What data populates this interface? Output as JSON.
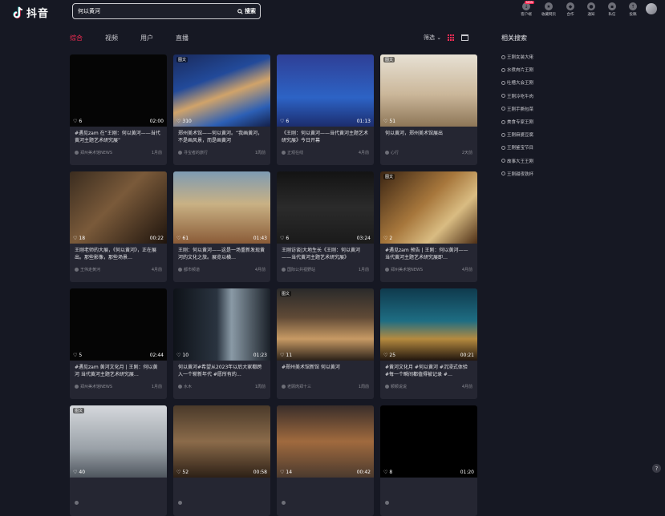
{
  "app": {
    "title": "抖音"
  },
  "search": {
    "value": "何以黄河",
    "button_label": "搜索"
  },
  "top_nav": [
    {
      "label": "客户端",
      "icon": "download-icon",
      "badge": "NEW"
    },
    {
      "label": "收藏网页",
      "icon": "star-icon"
    },
    {
      "label": "合作",
      "icon": "handshake-icon"
    },
    {
      "label": "通知",
      "icon": "bell-icon"
    },
    {
      "label": "私信",
      "icon": "message-icon"
    },
    {
      "label": "投稿",
      "icon": "upload-icon"
    }
  ],
  "filters": {
    "tabs": [
      "综合",
      "视频",
      "用户",
      "直播"
    ],
    "active": "综合",
    "filter_label": "筛选"
  },
  "cards": [
    {
      "thumb": "t-black",
      "likes": "6",
      "duration": "02:00",
      "tag": "",
      "desc": "#遇见zam 在“王刚：何以黄河——当代黄河主题艺术研究展”",
      "author": "郑州美术馆NEWS",
      "time": "1月前"
    },
    {
      "thumb": "t-map",
      "likes": "310",
      "duration": "",
      "tag": "图文",
      "desc": "郑州美术馆——何以黄河。“我画黄河，不是画风景，而是画黄河",
      "author": "寻宝者的旅行",
      "time": "1周前"
    },
    {
      "thumb": "t-poster",
      "likes": "6",
      "duration": "01:13",
      "tag": "",
      "desc": "《王刚：何以黄河——当代黄河主题艺术研究展》今日开幕",
      "author": "正观在线",
      "time": "4月前"
    },
    {
      "thumb": "t-hall",
      "likes": "51",
      "duration": "",
      "tag": "图文",
      "desc": "何以黄河，郑州美术馆展出",
      "author": "心行",
      "time": "2天前"
    },
    {
      "thumb": "t-museum",
      "likes": "18",
      "duration": "00:22",
      "tag": "",
      "desc": "王刚老师的大展，《何以黄河》，正在展出。那些影像，那些场景…",
      "author": "王伟走黄河",
      "time": "4月前"
    },
    {
      "thumb": "t-painting",
      "likes": "61",
      "duration": "01:43",
      "tag": "",
      "desc": "王刚：何以黄河——这是一场重新发现黄河的文化之旅。展览以横…",
      "author": "都市频道",
      "time": "4月前"
    },
    {
      "thumb": "t-news",
      "likes": "6",
      "duration": "03:24",
      "tag": "",
      "desc": "王刚访谈|大地生长《王刚：何以黄河——当代黄河主题艺术研究展》",
      "author": "国际公共视野站",
      "time": "1月前"
    },
    {
      "thumb": "t-gold",
      "likes": "2",
      "duration": "",
      "tag": "图文",
      "desc": "#遇见zam 预告 | 王刚：何以黄河——当代黄河主题艺术研究展即…",
      "author": "郑州美术馆NEWS",
      "time": "4月前"
    },
    {
      "thumb": "t-black",
      "likes": "5",
      "duration": "02:44",
      "tag": "",
      "desc": "#遇见zam 黄河文化月 | 王刚：何以黄河 当代黄河主题艺术研究展…",
      "author": "郑州美术馆NEWS",
      "time": "1月前"
    },
    {
      "thumb": "t-corridor",
      "likes": "10",
      "duration": "01:23",
      "tag": "",
      "desc": "何以黄河#希望从2023年以后大家都跨入一个崭新年代 #愿所有的…",
      "author": "水木",
      "time": "1周前"
    },
    {
      "thumb": "t-gallery",
      "likes": "11",
      "duration": "",
      "tag": "图文",
      "desc": "#郑州美术馆新馆 何以黄河",
      "author": "老顾肉郑十三",
      "time": "1周前"
    },
    {
      "thumb": "t-art",
      "likes": "25",
      "duration": "00:21",
      "tag": "",
      "desc": "#黄河文化月 #何以黄河 #沉浸式体验 #每一个瞬间都值得被记录 #…",
      "author": "颖颖说说",
      "time": "4月前"
    },
    {
      "thumb": "t-building",
      "likes": "40",
      "duration": "",
      "tag": "图文",
      "desc": "",
      "author": "",
      "time": ""
    },
    {
      "thumb": "t-sepia",
      "likes": "52",
      "duration": "00:58",
      "tag": "",
      "desc": "",
      "author": "",
      "time": ""
    },
    {
      "thumb": "t-room",
      "likes": "14",
      "duration": "00:42",
      "tag": "",
      "desc": "",
      "author": "",
      "time": ""
    },
    {
      "thumb": "t-title",
      "likes": "8",
      "duration": "01:20",
      "tag": "",
      "desc": "",
      "author": "",
      "time": ""
    }
  ],
  "related": {
    "title": "相关搜索",
    "items": [
      "王刚女装大佬",
      "水煮肉片王刚",
      "吐槽大会王刚",
      "王刚冷吃牛肉",
      "王刚手撕包菜",
      "美食专家王刚",
      "王刚麻婆豆腐",
      "王刚鉴宝节目",
      "故事大王王刚",
      "王刚甜夜铁杯"
    ]
  },
  "help_label": "?"
}
